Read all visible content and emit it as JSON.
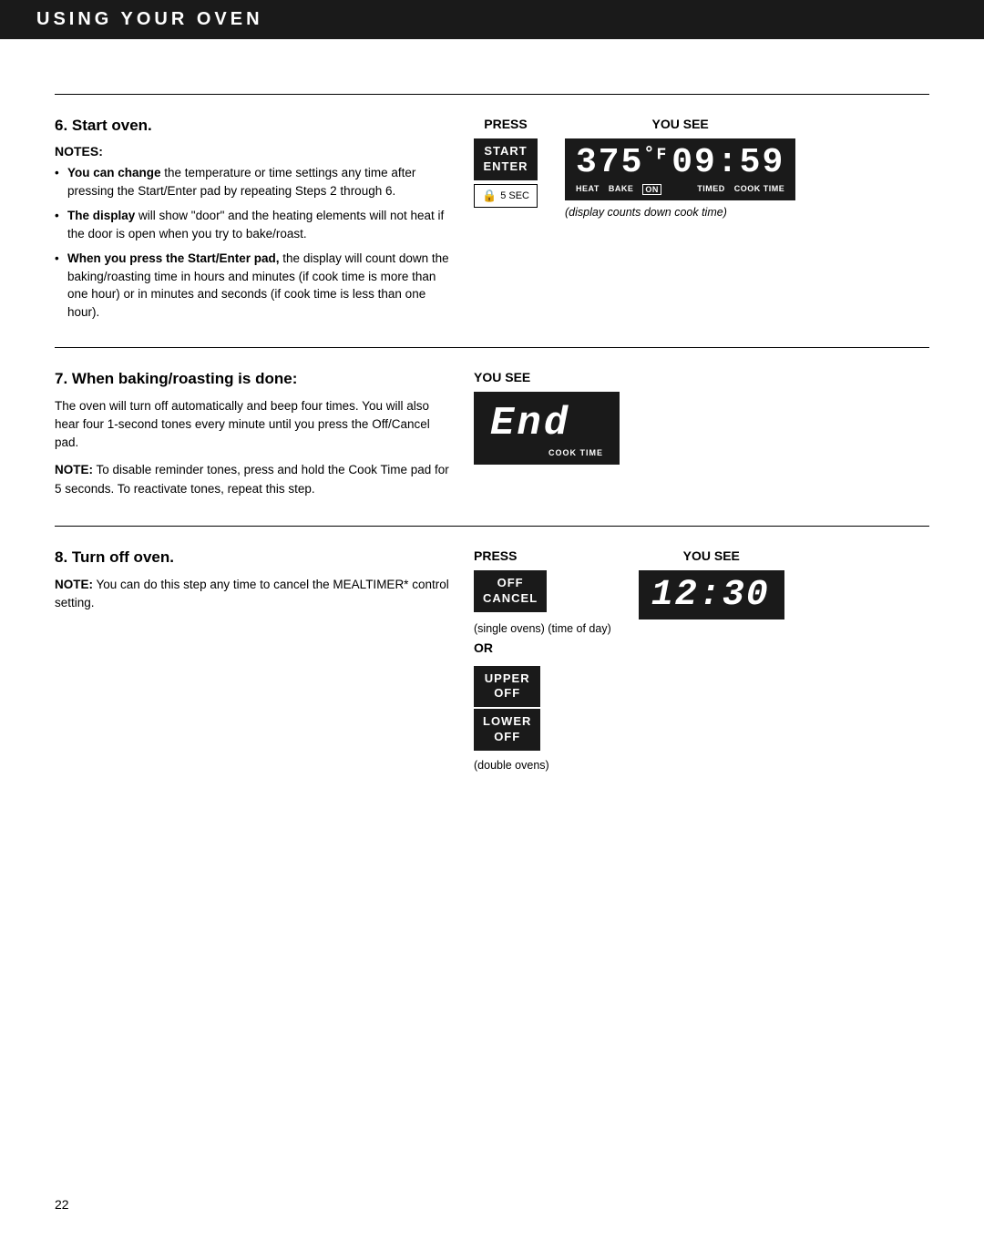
{
  "header": {
    "title": "USING YOUR OVEN"
  },
  "page_number": "22",
  "section6": {
    "title": "6. Start oven.",
    "notes_label": "NOTES:",
    "notes": [
      {
        "text_bold": "You can change",
        "text_rest": " the temperature or time settings any time after pressing the Start/Enter pad by repeating Steps 2 through 6."
      },
      {
        "text_bold": "The display",
        "text_rest": " will show “door” and the heating elements will not heat if the door is open when you try to bake/roast."
      },
      {
        "text_bold": "When you press the Start/Enter pad,",
        "text_rest": " the display will count down the baking/roasting time in hours and minutes (if cook time is more than one hour) or in minutes and seconds (if cook time is less than one hour)."
      }
    ],
    "press_col_label": "PRESS",
    "you_see_col_label": "YOU SEE",
    "press_buttons": [
      {
        "label": "START\nENTER"
      },
      {
        "label": "🔒  5 SEC",
        "outline": true
      }
    ],
    "display": {
      "digits": "375°F09:59",
      "labels": [
        "HEAT",
        "BAKE",
        "ON",
        "TIMED",
        "COOK TIME"
      ]
    },
    "display_caption": "(display counts down cook time)"
  },
  "section7": {
    "title": "7. When baking/roasting is done:",
    "body": "The oven will turn off automatically and beep four times. You will also hear four 1-second tones every minute until you press the Off/Cancel pad.",
    "note_label": "NOTE:",
    "note_text": "To disable reminder tones, press and hold the Cook Time pad for 5 seconds. To reactivate tones, repeat this step.",
    "you_see_col_label": "YOU SEE",
    "display_end_text": "End",
    "display_end_label": "COOK TIME"
  },
  "section8": {
    "title": "8. Turn off oven.",
    "note_label": "NOTE:",
    "note_text": "You can do this step any time to cancel the MEALTIMER* control setting.",
    "press_col_label": "PRESS",
    "you_see_col_label": "YOU SEE",
    "press_buttons": [
      {
        "label": "OFF\nCANCEL"
      }
    ],
    "display_time_digits": "12:30",
    "caption_single": "(single ovens)  (time of day)",
    "or_label": "OR",
    "press_buttons2": [
      {
        "label": "UPPER\nOFF"
      },
      {
        "label": "LOWER\nOFF"
      }
    ],
    "caption_double": "(double ovens)"
  }
}
